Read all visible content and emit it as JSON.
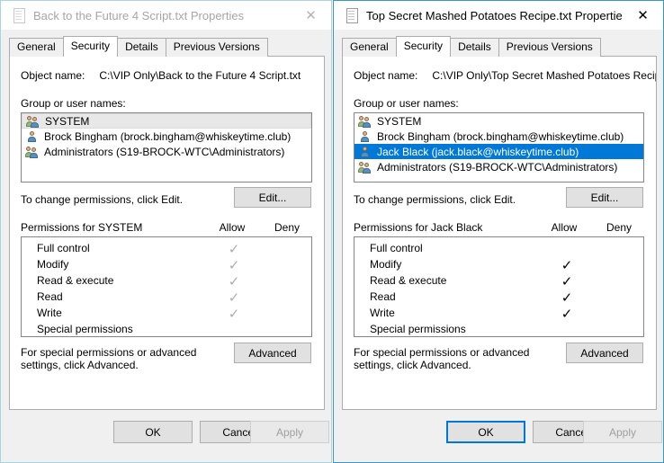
{
  "colors": {
    "window_border_active": "#3a96c4",
    "window_border_inactive": "#a8d4e8",
    "selection_focused": "#0078d7",
    "selection_unfocused": "#e8e8e8",
    "check_enabled": "#000000",
    "check_disabled": "#adadad"
  },
  "dialogs": [
    {
      "id": "left",
      "active": false,
      "titlebar": {
        "icon": "text-file-icon",
        "title": "Back to the Future 4 Script.txt Properties",
        "close_label": "✕"
      },
      "tabs": [
        {
          "label": "General",
          "active": false
        },
        {
          "label": "Security",
          "active": true
        },
        {
          "label": "Details",
          "active": false
        },
        {
          "label": "Previous Versions",
          "active": false
        }
      ],
      "object_name": {
        "label": "Object name:",
        "value": "C:\\VIP Only\\Back to the Future 4 Script.txt"
      },
      "group_label": "Group or user names:",
      "users": [
        {
          "name": "SYSTEM",
          "icon": "group-icon",
          "state": "selected-unfocused"
        },
        {
          "name": "Brock Bingham (brock.bingham@whiskeytime.club)",
          "icon": "user-icon",
          "state": "normal"
        },
        {
          "name": "Administrators (S19-BROCK-WTC\\Administrators)",
          "icon": "group-icon",
          "state": "normal"
        }
      ],
      "edit_hint": "To change permissions, click Edit.",
      "edit_button": "Edit...",
      "permissions_title": "Permissions for SYSTEM",
      "col_allow": "Allow",
      "col_deny": "Deny",
      "permissions": [
        {
          "name": "Full control",
          "allow": "grey-check",
          "deny": "none"
        },
        {
          "name": "Modify",
          "allow": "grey-check",
          "deny": "none"
        },
        {
          "name": "Read & execute",
          "allow": "grey-check",
          "deny": "none"
        },
        {
          "name": "Read",
          "allow": "grey-check",
          "deny": "none"
        },
        {
          "name": "Write",
          "allow": "grey-check",
          "deny": "none"
        },
        {
          "name": "Special permissions",
          "allow": "none",
          "deny": "none"
        }
      ],
      "advanced_hint": "For special permissions or advanced settings, click Advanced.",
      "advanced_button": "Advanced",
      "buttons": {
        "ok": "OK",
        "cancel": "Cancel",
        "apply": "Apply",
        "apply_enabled": false,
        "ok_focused": false
      }
    },
    {
      "id": "right",
      "active": true,
      "titlebar": {
        "icon": "text-file-icon",
        "title": "Top Secret Mashed Potatoes Recipe.txt Properties",
        "close_label": "✕"
      },
      "tabs": [
        {
          "label": "General",
          "active": false
        },
        {
          "label": "Security",
          "active": true
        },
        {
          "label": "Details",
          "active": false
        },
        {
          "label": "Previous Versions",
          "active": false
        }
      ],
      "object_name": {
        "label": "Object name:",
        "value": "C:\\VIP Only\\Top Secret Mashed Potatoes Recipe.txt"
      },
      "group_label": "Group or user names:",
      "users": [
        {
          "name": "SYSTEM",
          "icon": "group-icon",
          "state": "normal"
        },
        {
          "name": "Brock Bingham (brock.bingham@whiskeytime.club)",
          "icon": "user-icon",
          "state": "normal"
        },
        {
          "name": "Jack Black (jack.black@whiskeytime.club)",
          "icon": "user-icon",
          "state": "selected-focused"
        },
        {
          "name": "Administrators (S19-BROCK-WTC\\Administrators)",
          "icon": "group-icon",
          "state": "normal"
        }
      ],
      "edit_hint": "To change permissions, click Edit.",
      "edit_button": "Edit...",
      "permissions_title": "Permissions for Jack Black",
      "col_allow": "Allow",
      "col_deny": "Deny",
      "permissions": [
        {
          "name": "Full control",
          "allow": "none",
          "deny": "none"
        },
        {
          "name": "Modify",
          "allow": "black-check",
          "deny": "none"
        },
        {
          "name": "Read & execute",
          "allow": "black-check",
          "deny": "none"
        },
        {
          "name": "Read",
          "allow": "black-check",
          "deny": "none"
        },
        {
          "name": "Write",
          "allow": "black-check",
          "deny": "none"
        },
        {
          "name": "Special permissions",
          "allow": "none",
          "deny": "none"
        }
      ],
      "advanced_hint": "For special permissions or advanced settings, click Advanced.",
      "advanced_button": "Advanced",
      "buttons": {
        "ok": "OK",
        "cancel": "Cancel",
        "apply": "Apply",
        "apply_enabled": false,
        "ok_focused": true
      }
    }
  ]
}
